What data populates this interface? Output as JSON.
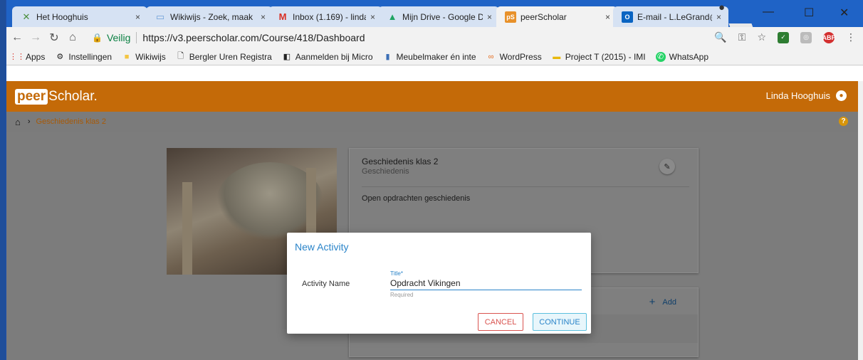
{
  "browser": {
    "tabs": [
      {
        "label": "Het Hooghuis",
        "icon": "hooghuis-favicon"
      },
      {
        "label": "Wikiwijs - Zoek, maak",
        "icon": "wikiwijs-favicon"
      },
      {
        "label": "Inbox (1.169) - lindal",
        "icon": "gmail-favicon"
      },
      {
        "label": "Mijn Drive - Google D",
        "icon": "drive-favicon"
      },
      {
        "label": "peerScholar",
        "icon": "peerscholar-favicon"
      },
      {
        "label": "E-mail - L.LeGrand@",
        "icon": "outlook-favicon"
      }
    ],
    "secure_label": "Veilig",
    "url": "https://v3.peerscholar.com/Course/418/Dashboard",
    "bookmarks": [
      "Apps",
      "Instellingen",
      "Wikiwijs",
      "Bergler Uren Registra",
      "Aanmelden bij Micro",
      "Meubelmaker én inte",
      "WordPress",
      "Project T (2015) - IMI",
      "WhatsApp"
    ]
  },
  "app": {
    "logo_peer": "peer",
    "logo_scholar": "Scholar.",
    "user_name": "Linda Hooghuis",
    "breadcrumb": "Geschiedenis klas 2",
    "help_glyph": "?"
  },
  "course": {
    "title": "Geschiedenis klas 2",
    "subject": "Geschiedenis",
    "description": "Open opdrachten geschiedenis",
    "add_label": "Add"
  },
  "modal": {
    "title": "New Activity",
    "field_label": "Activity Name",
    "input_label": "Title*",
    "input_value": "Opdracht Vikingen",
    "helper": "Required",
    "cancel_label": "CANCEL",
    "continue_label": "CONTINUE"
  },
  "colors": {
    "brand": "#c46a08",
    "accent": "#2a84c9",
    "danger": "#d9534f"
  }
}
